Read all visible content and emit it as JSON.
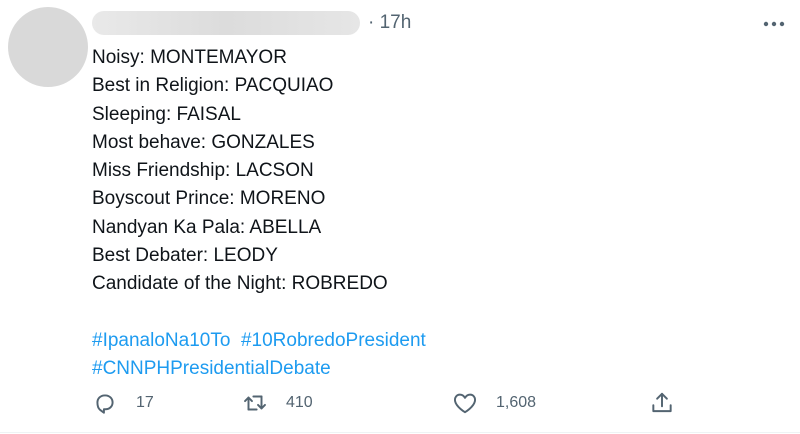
{
  "tweet": {
    "time": "17h",
    "dot": "·",
    "lines": [
      "Noisy: MONTEMAYOR",
      "Best in Religion: PACQUIAO",
      "Sleeping: FAISAL",
      "Most behave: GONZALES",
      "Miss Friendship: LACSON",
      "Boyscout Prince: MORENO",
      "Nandyan Ka Pala: ABELLA",
      "Best Debater: LEODY",
      "Candidate of the Night: ROBREDO"
    ],
    "hashtags": [
      "#IpanaloNa10To",
      "#10RobredoPresident",
      "#CNNPHPresidentialDebate"
    ]
  },
  "actions": {
    "reply_count": "17",
    "retweet_count": "410",
    "like_count": "1,608"
  },
  "icons": {
    "more": "more-horizontal-icon",
    "reply": "reply-icon",
    "retweet": "retweet-icon",
    "like": "heart-icon",
    "share": "share-icon"
  },
  "colors": {
    "link": "#1d9bf0",
    "secondary_text": "#536471",
    "text": "#0f1419"
  }
}
